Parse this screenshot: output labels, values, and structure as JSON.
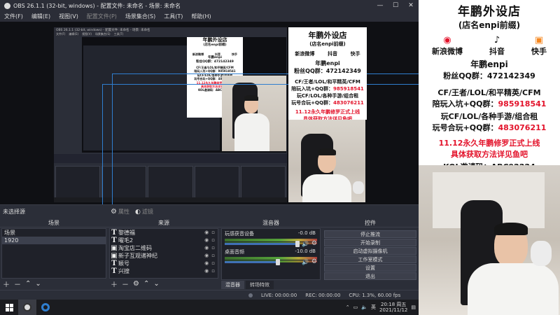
{
  "window": {
    "title": "OBS 26.1.1 (32-bit, windows) - 配置文件: 未命名 - 场景: 未命名",
    "controls": [
      "—",
      "☐",
      "✕"
    ]
  },
  "menu": [
    "文件(F)",
    "编辑(E)",
    "视图(V)",
    "配置文件(P)",
    "场景集合(S)",
    "工具(T)",
    "帮助(H)"
  ],
  "scene_label": "未选择源",
  "props": {
    "properties": "属性",
    "filters": "滤镜"
  },
  "docks": {
    "scenes": {
      "title": "场景",
      "items": [
        "场景",
        "1920"
      ]
    },
    "sources": {
      "title": "来源",
      "items": [
        {
          "t": "T",
          "name": "黎德福"
        },
        {
          "t": "T",
          "name": "曜毛2"
        },
        {
          "t": "▣",
          "name": "淘宝店二维码"
        },
        {
          "t": "▣",
          "name": "新子互观诸神纪"
        },
        {
          "t": "T",
          "name": "颖号"
        },
        {
          "t": "T",
          "name": "兴搜"
        }
      ]
    },
    "mixer": {
      "title": "混音器",
      "tracks": [
        {
          "name": "玩感获音设备",
          "db": "-0.0 dB"
        },
        {
          "name": "桌面音频",
          "db": "-10.0 dB"
        }
      ],
      "tabs": [
        "混音器",
        "转场特效"
      ]
    },
    "controls": {
      "title": "控件",
      "buttons": [
        "停止推流",
        "开始录制",
        "启动虚拟摄像机",
        "工作室模式",
        "设置",
        "退出"
      ]
    }
  },
  "status": {
    "live": "LIVE: 00:00:00",
    "rec": "REC: 00:00:00",
    "cpu": "CPU: 1.3%, 60.00 fps"
  },
  "card": {
    "title": "年鹏外设店",
    "subtitle": "(店名enpi前缀)",
    "social": [
      {
        "name": "新浪微博",
        "icon": "weibo-icon"
      },
      {
        "name": "抖音",
        "icon": "douyin-icon"
      },
      {
        "name": "快手",
        "icon": "kuaishou-icon"
      }
    ],
    "handle": "年鹏enpi",
    "qq": "粉丝QQ群：472142349",
    "line1": "CF/王者/LOL/和平精英/CFM",
    "line2_a": "陪玩入坑+QQ群：",
    "line2_b": "985918541",
    "line3": "玩CF/LOL/各种手游/组合租",
    "line4_a": "玩号合玩+QQ群：",
    "line4_b": "483076211",
    "promo1": "11.12永久年鹏修罗正式上线",
    "promo2": "具体获取方法详见鱼吧",
    "kol": "KOL邀请码：ABC92224"
  },
  "nested_card": {
    "line1": "CF/王者/LOL/和平精英/CFM",
    "line2": "陪玩入坑+QQ群：985918541",
    "line3": "玩CF/LOL/各种手游/组合租",
    "line4": "玩号合玩+QQ群：483076211",
    "promo1": "11.12永久年鹏修罗正式上线",
    "promo2": "具体获取方法详见鱼吧",
    "kol": "KOL邀请码：ABC92224",
    "title": "年鹏外设店",
    "subtitle": "(店名enpi前缀)",
    "social": [
      "新浪微博",
      "抖音",
      "快手"
    ],
    "handle": "年鹏enpi",
    "qq": "粉丝QQ群：472142349"
  },
  "taskbar": {
    "time": "20:18 周五",
    "date": "2021/11/12"
  },
  "colors": {
    "red": "#e3132b",
    "blue": "#2f7ecf",
    "obs_bg": "#2b2e38"
  }
}
